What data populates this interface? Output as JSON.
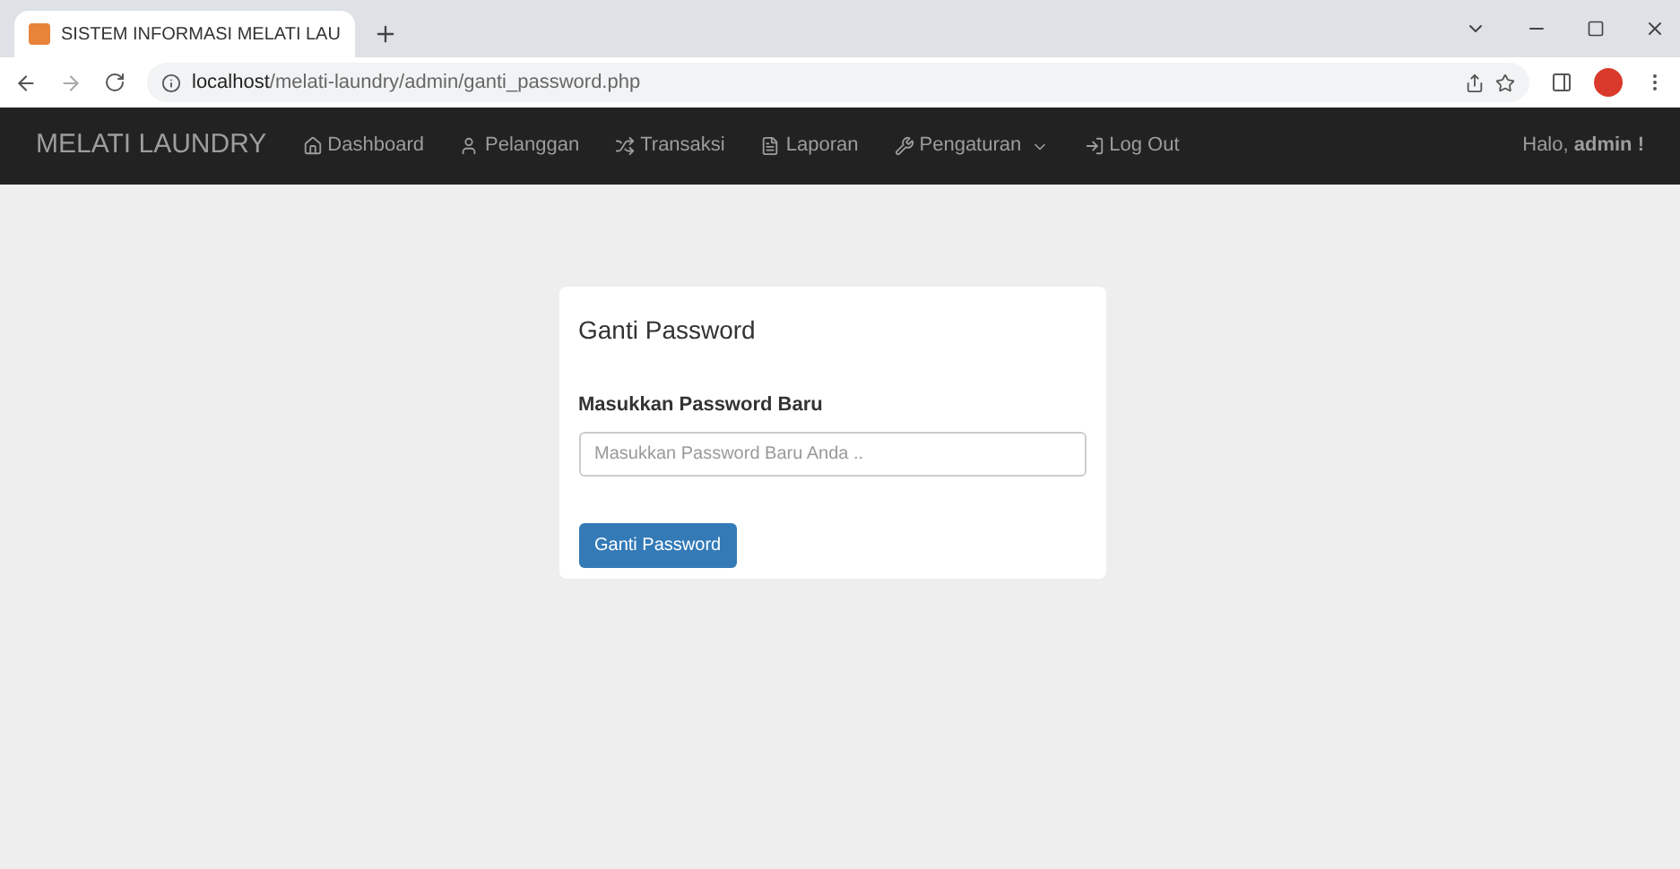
{
  "browser": {
    "tab_title": "SISTEM INFORMASI MELATI LAU",
    "url_host": "localhost",
    "url_path": "/melati-laundry/admin/ganti_password.php"
  },
  "navbar": {
    "brand": "MELATI LAUNDRY",
    "items": [
      {
        "label": "Dashboard",
        "dropdown": false
      },
      {
        "label": "Pelanggan",
        "dropdown": false
      },
      {
        "label": "Transaksi",
        "dropdown": false
      },
      {
        "label": "Laporan",
        "dropdown": false
      },
      {
        "label": "Pengaturan",
        "dropdown": true
      },
      {
        "label": "Log Out",
        "dropdown": false
      }
    ],
    "greeting": "Halo, **admin !**"
  },
  "card": {
    "title": "Ganti Password",
    "field_label": "Masukkan Password Baru",
    "placeholder": "Masukkan Password Baru Anda ..",
    "button": "Ganti Password"
  }
}
